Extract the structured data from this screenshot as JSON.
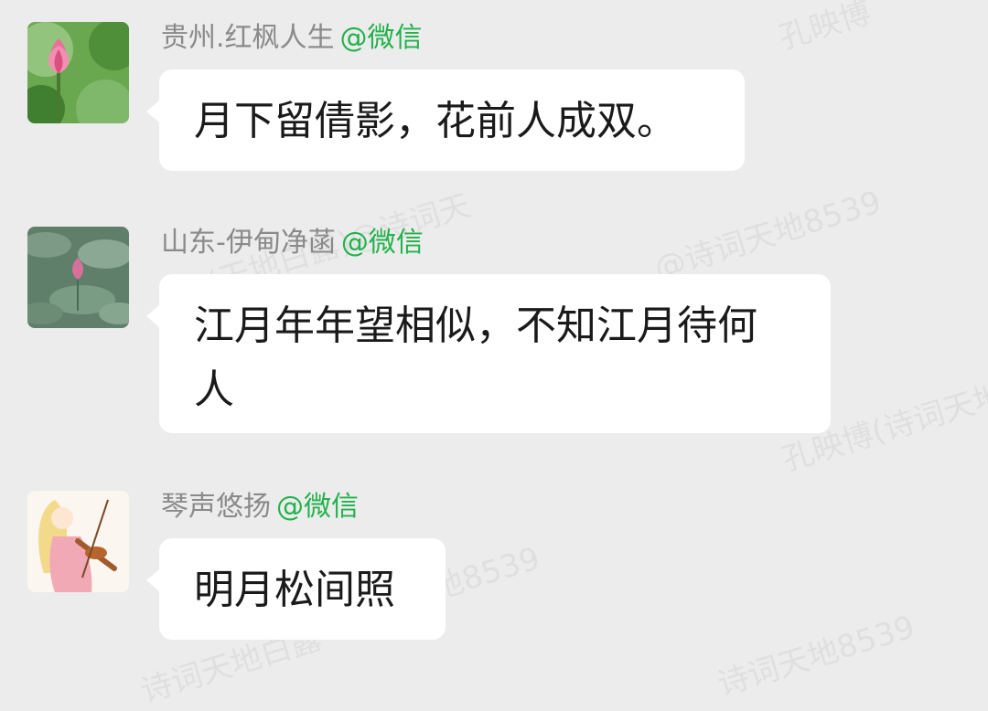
{
  "messages": [
    {
      "sender": "贵州.红枫人生",
      "source": "@微信",
      "text": "月下留倩影，花前人成双。",
      "avatar": "lotus-flower-avatar"
    },
    {
      "sender": "山东-伊甸净菡",
      "source": "@微信",
      "text": "江月年年望相似，不知江月待何人",
      "avatar": "lotus-pond-avatar"
    },
    {
      "sender": "琴声悠扬",
      "source": "@微信",
      "text": "明月松间照",
      "avatar": "violinist-avatar"
    }
  ],
  "watermarks": [
    "孔映博",
    "(天地白露)@诗词天",
    "@诗词天地8539",
    "孔映博(诗词天地",
    "地8539",
    "诗词天地白露",
    "诗词天地8539"
  ],
  "colors": {
    "background": "#ececec",
    "bubble": "#ffffff",
    "sender": "#8a8a8a",
    "source": "#22b24c"
  }
}
